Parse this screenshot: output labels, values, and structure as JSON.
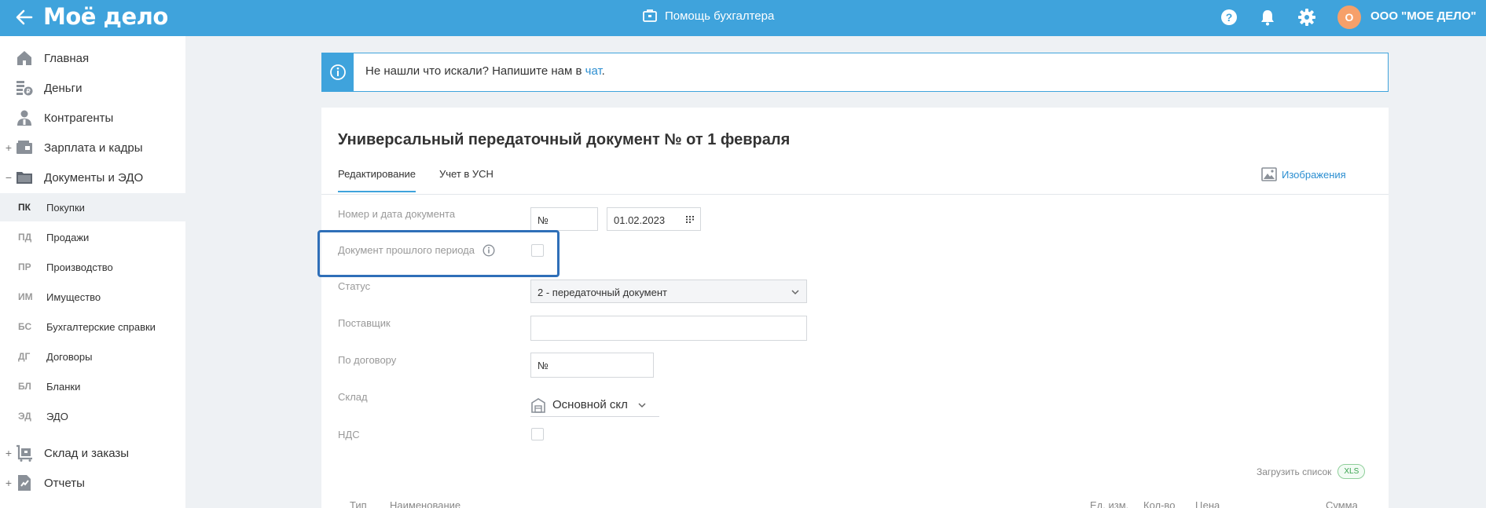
{
  "topbar": {
    "logo": "Моё дело",
    "helper_label": "Помощь бухгалтера",
    "avatar_letter": "О",
    "org_name": "ООО \"МОЕ ДЕЛО\""
  },
  "sidebar": {
    "items": [
      {
        "label": "Главная",
        "icon": "home-icon",
        "plus": ""
      },
      {
        "label": "Деньги",
        "icon": "money-icon",
        "plus": ""
      },
      {
        "label": "Контрагенты",
        "icon": "contractor-icon",
        "plus": ""
      },
      {
        "label": "Зарплата и кадры",
        "icon": "wallet-icon",
        "plus": "+"
      },
      {
        "label": "Документы и ЭДО",
        "icon": "folder-icon",
        "plus": "−"
      },
      {
        "label": "Склад и заказы",
        "icon": "warehouse-cart-icon",
        "plus": "+"
      },
      {
        "label": "Отчеты",
        "icon": "report-icon",
        "plus": "+"
      }
    ],
    "sub_items": [
      {
        "code": "ПК",
        "label": "Покупки"
      },
      {
        "code": "ПД",
        "label": "Продажи"
      },
      {
        "code": "ПР",
        "label": "Производство"
      },
      {
        "code": "ИМ",
        "label": "Имущество"
      },
      {
        "code": "БС",
        "label": "Бухгалтерские справки"
      },
      {
        "code": "ДГ",
        "label": "Договоры"
      },
      {
        "code": "БЛ",
        "label": "Бланки"
      },
      {
        "code": "ЭД",
        "label": "ЭДО"
      }
    ]
  },
  "banner": {
    "text": "Не нашли что искали? Напишите нам в ",
    "link": "чат",
    "after": "."
  },
  "document": {
    "title": "Универсальный передаточный документ № от 1 февраля",
    "tabs": [
      "Редактирование",
      "Учет в УСН"
    ],
    "images_link": "Изображения",
    "fields": {
      "number_date_label": "Номер и дата документа",
      "number_value": "№",
      "date_value": "01.02.2023",
      "past_period_label": "Документ прошлого периода",
      "status_label": "Статус",
      "status_value": "2 - передаточный документ",
      "supplier_label": "Поставщик",
      "supplier_value": "",
      "contract_label": "По договору",
      "contract_value": "№",
      "warehouse_label": "Склад",
      "warehouse_value": "Основной скл",
      "vat_label": "НДС"
    },
    "upload_label": "Загрузить список",
    "xls_badge": "XLS",
    "table_headers": [
      "Тип",
      "Наименование",
      "Ед. изм.",
      "Кол-во",
      "Цена",
      "Сумма"
    ]
  }
}
